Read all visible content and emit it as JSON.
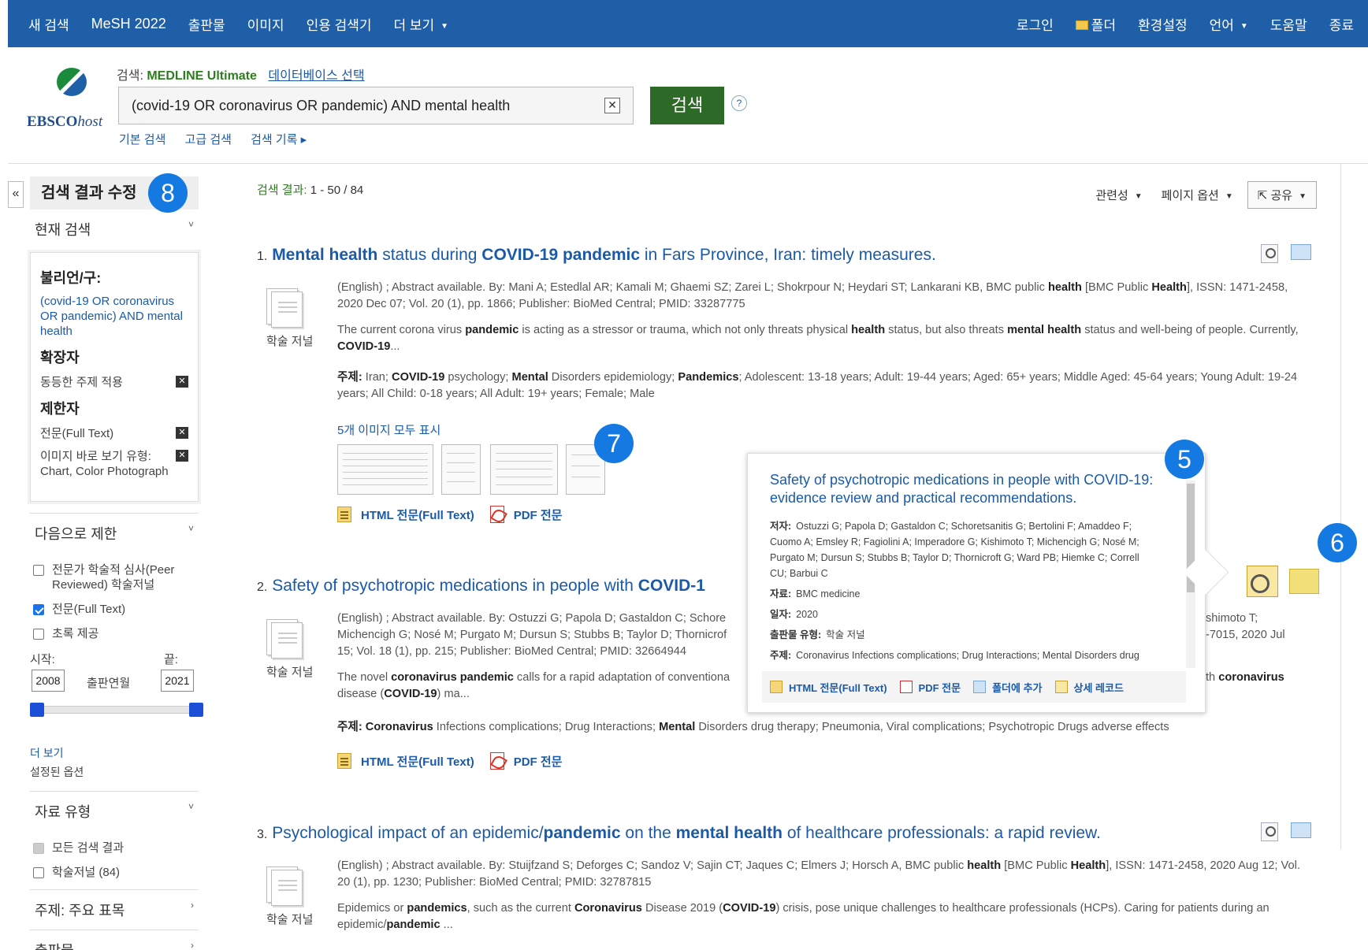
{
  "topbar": {
    "left": [
      "새 검색",
      "MeSH 2022",
      "출판물",
      "이미지",
      "인용 검색기"
    ],
    "more": "더 보기",
    "right": {
      "login": "로그인",
      "folder": "폴더",
      "settings": "환경설정",
      "language": "언어",
      "help": "도움말",
      "exit": "종료"
    }
  },
  "header": {
    "logo": {
      "ebsco": "EBSCO",
      "host": "host"
    },
    "db_prefix": "검색:",
    "db_name": "MEDLINE Ultimate",
    "db_select": "데이터베이스 선택",
    "query": "(covid-19 OR coronavirus OR pandemic) AND mental health",
    "search_button": "검색",
    "help": "?",
    "links": [
      "기본 검색",
      "고급 검색",
      "검색 기록 ▸"
    ]
  },
  "sidebar": {
    "collapse": "«",
    "refine_title": "검색 결과 수정",
    "current_search": "현재 검색",
    "boolean_label": "불리언/구:",
    "boolean_value": "(covid-19 OR coronavirus OR pandemic) AND mental health",
    "expanders_label": "확장자",
    "expander": "동등한 주제 적용",
    "limiters_label": "제한자",
    "limiter_fulltext": "전문(Full Text)",
    "limiter_image": "이미지 바로 보기 유형: Chart, Color Photograph",
    "limit_to": "다음으로 제한",
    "peer_reviewed": "전문가 학술적 심사(Peer Reviewed) 학술저널",
    "full_text": "전문(Full Text)",
    "abstract": "초록 제공",
    "start_label": "시작:",
    "end_label": "끝:",
    "start_year": "2008",
    "pub_date": "출판연월",
    "end_year": "2021",
    "more": "더 보기",
    "set_options": "설정된 옵션",
    "source_types": "자료 유형",
    "all_results": "모든 검색 결과",
    "journals": "학술저널 (84)",
    "subject_major": "주제: 주요 표목",
    "publication": "출판물"
  },
  "results_header": {
    "label": "검색 결과:",
    "range": "1 - 50 / 84",
    "relevance": "관련성",
    "page_options": "페이지 옵션",
    "share": "공유"
  },
  "results": [
    {
      "num": "1.",
      "title_html": "<b>Mental health</b> status during <b>COVID-19 pandemic</b> in Fars Province, Iran: timely measures.",
      "type": "학술 저널",
      "meta_html": "(English) ; Abstract available. By: Mani A; Estedlal AR; Kamali M; Ghaemi SZ; Zarei L; Shokrpour N; Heydari ST; Lankarani KB, BMC public <b>health</b> [BMC Public <b>Health</b>], ISSN: 1471-2458, 2020 Dec 07; Vol. 20 (1), pp. 1866; Publisher: BioMed Central; PMID: 33287775",
      "abstract_html": "The current corona virus <b>pandemic</b> is acting as a stressor or trauma, which not only threats physical <b>health</b> status, but also threats <b>mental health</b> status and well-being of people. Currently, <b>COVID-19</b>...",
      "subjects_html": "<b>주제:</b> Iran; <b>COVID-19</b> psychology; <b>Mental</b> Disorders epidemiology; <b>Pandemics</b>; Adolescent: 13-18 years; Adult: 19-44 years; Aged: 65+ years; Middle Aged: 45-64 years; Young Adult: 19-24 years; All Child: 0-18 years; All Adult: 19+ years; Female; Male",
      "images_link": "5개 이미지 모두 표시",
      "html_link": "HTML 전문(Full Text)",
      "pdf_link": "PDF 전문"
    },
    {
      "num": "2.",
      "title_html": "Safety of psychotropic medications in people with <b>COVID-1</b>",
      "type": "학술 저널",
      "meta_left_html": "(English) ; Abstract available. By: Ostuzzi G; Papola D; Gastaldon C; Schore<br>Michencigh G; Nosé M; Purgato M; Dursun S; Stubbs B; Taylor D; Thornicrof<br>15; Vol. 18 (1), pp. 215; Publisher: BioMed Central; PMID: 32664944",
      "meta_right_html": "shimoto T;<br>-7015, 2020 Jul",
      "abstract_left_html": "The novel <b>coronavirus pandemic</b> calls for a rapid adaptation of conventiona<br>disease (<b>COVID-19</b>) ma...",
      "abstract_right_html": "th <b>coronavirus</b>",
      "subjects_html": "<b>주제:</b> <b>Coronavirus</b> Infections complications; Drug Interactions; <b>Mental</b> Disorders drug therapy; Pneumonia, Viral complications; Psychotropic Drugs adverse effects",
      "html_link": "HTML 전문(Full Text)",
      "pdf_link": "PDF 전문"
    },
    {
      "num": "3.",
      "title_html": "Psychological impact of an epidemic/<b>pandemic</b> on the <b>mental health</b> of healthcare professionals: a rapid review.",
      "type": "학술 저널",
      "meta_html": "(English) ; Abstract available. By: Stuijfzand S; Deforges C; Sandoz V; Sajin CT; Jaques C; Elmers J; Horsch A, BMC public <b>health</b> [BMC Public <b>Health</b>], ISSN: 1471-2458, 2020 Aug 12; Vol. 20 (1), pp. 1230; Publisher: BioMed Central; PMID: 32787815",
      "abstract_html": "Epidemics or <b>pandemics</b>, such as the current <b>Coronavirus</b> Disease 2019 (<b>COVID-19</b>) crisis, pose unique challenges to healthcare professionals (HCPs). Caring for patients during an epidemic/<b>pandemic</b> ..."
    }
  ],
  "popup": {
    "title": "Safety of psychotropic medications in people with COVID-19: evidence review and practical recommendations.",
    "authors_label": "저자:",
    "authors": "Ostuzzi G; Papola D; Gastaldon C; Schoretsanitis G; Bertolini F; Amaddeo F; Cuomo A; Emsley R; Fagiolini A; Imperadore G; Kishimoto T; Michencigh G; Nosé M; Purgato M; Dursun S; Stubbs B; Taylor D; Thornicroft G; Ward PB; Hiemke C; Correll CU; Barbui C",
    "source_label": "자료:",
    "source": "BMC medicine",
    "date_label": "일자:",
    "date": "2020",
    "pubtype_label": "출판물 유형:",
    "pubtype": "학술 저널",
    "subject_label": "주제:",
    "subject": "Coronavirus Infections complications; Drug Interactions; Mental Disorders drug",
    "html_link": "HTML 전문(Full Text)",
    "pdf_link": "PDF 전문",
    "folder_link": "폴더에 추가",
    "detail_link": "상세 레코드"
  },
  "badges": [
    "8",
    "7",
    "5",
    "6"
  ]
}
